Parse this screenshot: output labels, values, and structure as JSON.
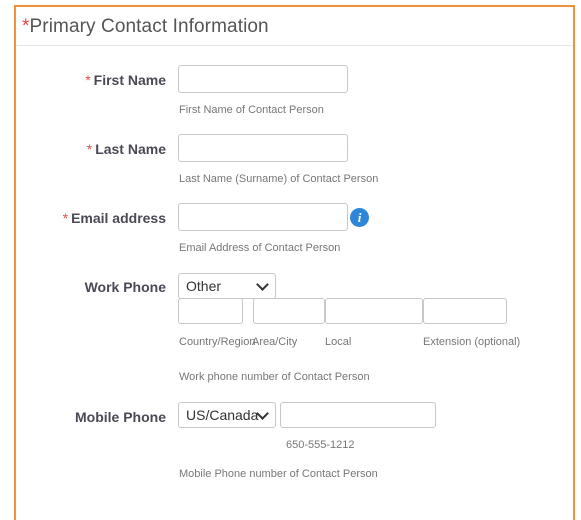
{
  "section": {
    "required_mark": "*",
    "title": "Primary Contact Information"
  },
  "first_name": {
    "required_mark": "*",
    "label": "First Name",
    "value": "",
    "hint": "First Name of Contact Person"
  },
  "last_name": {
    "required_mark": "*",
    "label": "Last Name",
    "value": "",
    "hint": "Last Name (Surname) of Contact Person"
  },
  "email": {
    "required_mark": "*",
    "label": "Email address",
    "value": "",
    "info_icon": "i",
    "hint": "Email Address of Contact Person"
  },
  "work_phone": {
    "label": "Work Phone",
    "type_selected": "Other",
    "sublabels": {
      "country_region": "Country/Region",
      "area_city": "Area/City",
      "local": "Local",
      "extension": "Extension (optional)"
    },
    "values": {
      "country_region": "",
      "area_city": "",
      "local": "",
      "extension": ""
    },
    "hint": "Work phone number of Contact Person"
  },
  "mobile_phone": {
    "label": "Mobile Phone",
    "country_selected": "US/Canada",
    "value": "",
    "example": "650-555-1212",
    "hint": "Mobile Phone number of Contact Person"
  },
  "colors": {
    "accent_border": "#f0923b",
    "required": "#e04b4b",
    "info": "#2d86d9"
  }
}
